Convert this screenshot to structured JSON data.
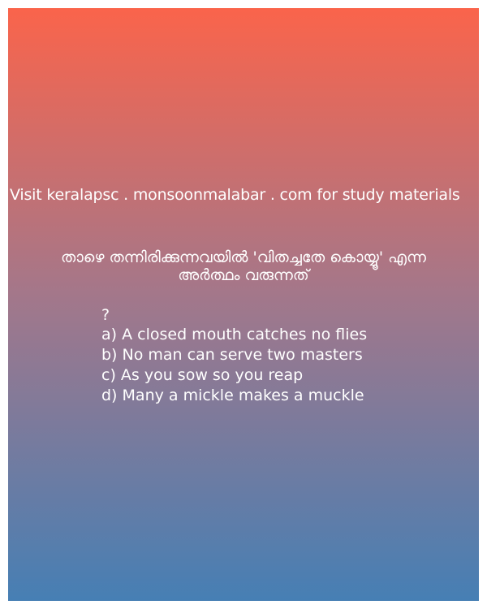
{
  "visit_text": "Visit keralapsc . monsoonmalabar . com for study materials",
  "question": {
    "line1": "താഴെ തന്നിരിക്കുന്നവയിൽ 'വിതച്ചതേ കൊയ്യൂ' എന്ന",
    "line2": "അർത്ഥം വരുന്നത്",
    "mark": "?"
  },
  "options": [
    {
      "letter": "a)",
      "text": "A closed mouth catches no flies"
    },
    {
      "letter": "b)",
      "text": "No man can serve two masters"
    },
    {
      "letter": "c)",
      "text": "As you sow so you reap"
    },
    {
      "letter": "d)",
      "text": "Many a mickle makes a muckle"
    }
  ],
  "colors": {
    "gradient_top": "#fa644b",
    "gradient_bottom": "#467fb4",
    "text": "#ffffff"
  }
}
